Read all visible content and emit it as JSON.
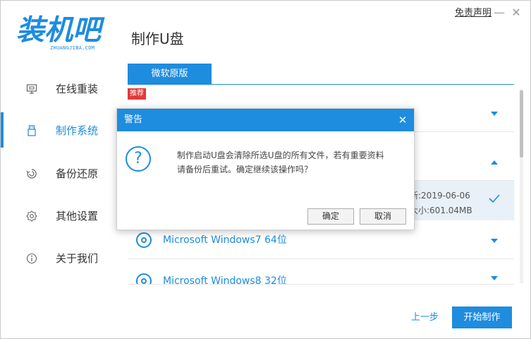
{
  "header": {
    "logo_text": "装机吧",
    "logo_sub": "ZHUANGJIBA.COM",
    "page_title": "制作U盘",
    "disclaimer": "免责声明",
    "minimize": "—",
    "close": "✕"
  },
  "sidebar": {
    "items": [
      {
        "label": "在线重装",
        "icon": "monitor-icon"
      },
      {
        "label": "制作系统",
        "icon": "usb-drive-icon",
        "active": true
      },
      {
        "label": "备份还原",
        "icon": "backup-restore-icon"
      },
      {
        "label": "其他设置",
        "icon": "gear-icon"
      },
      {
        "label": "关于我们",
        "icon": "info-icon"
      }
    ]
  },
  "tabs": [
    {
      "label": "微软原版",
      "active": true
    }
  ],
  "list": {
    "recommend_badge": "推荐",
    "selected_meta": {
      "updated": "新:2019-06-06",
      "size": "大小:601.04MB"
    },
    "items": [
      {
        "name": "Microsoft Windows7 64位"
      },
      {
        "name": "Microsoft Windows8 32位"
      }
    ]
  },
  "footer": {
    "prev_label": "上一步",
    "start_label": "开始制作"
  },
  "dialog": {
    "title": "警告",
    "close": "✕",
    "icon": "question-icon",
    "icon_glyph": "?",
    "message_line1": "制作启动U盘会清除所选U盘的所有文件，若有重要资料",
    "message_line2": "请备份后重试。确定继续该操作吗？",
    "ok_label": "确定",
    "cancel_label": "取消"
  },
  "colors": {
    "accent": "#1e8cdf",
    "badge": "#e4393c",
    "selected_row": "#e8f0f8"
  }
}
